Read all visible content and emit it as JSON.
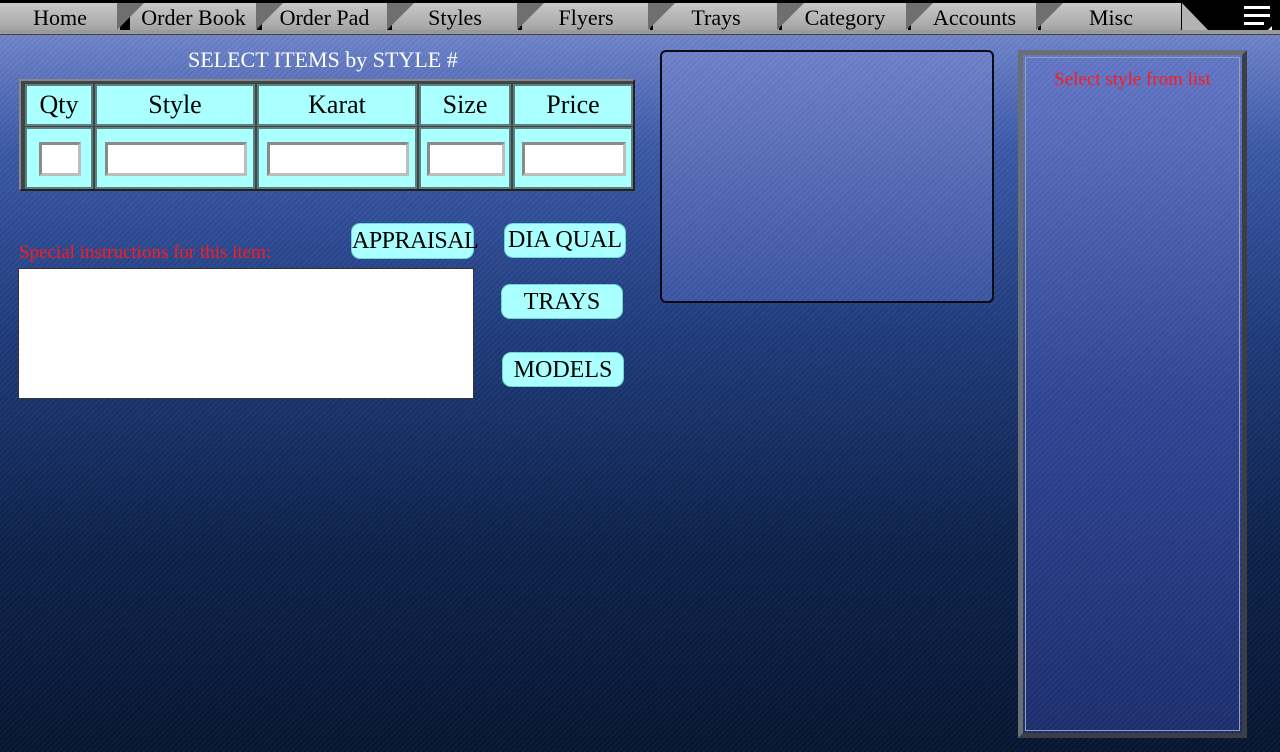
{
  "nav": {
    "tabs": [
      {
        "label": "Home"
      },
      {
        "label": "Order Book"
      },
      {
        "label": "Order Pad"
      },
      {
        "label": "Styles"
      },
      {
        "label": "Flyers"
      },
      {
        "label": "Trays"
      },
      {
        "label": "Category"
      },
      {
        "label": "Accounts"
      },
      {
        "label": "Misc"
      }
    ],
    "menu_icon": "hamburger-menu-icon"
  },
  "section_title": "SELECT ITEMS by STYLE #",
  "order_table": {
    "headers": [
      "Qty",
      "Style",
      "Karat",
      "Size",
      "Price"
    ],
    "values": [
      "",
      "",
      "",
      "",
      ""
    ]
  },
  "instructions": {
    "label": "Special instructions for this item:",
    "value": ""
  },
  "buttons": {
    "appraisal": "APPRAISAL",
    "dia_qual": "DIA QUAL",
    "trays": "TRAYS",
    "models": "MODELS"
  },
  "style_list": {
    "message": "Select style from list"
  },
  "colors": {
    "accent_cyan": "#aaffff",
    "warning_red": "#ff1a1a"
  }
}
